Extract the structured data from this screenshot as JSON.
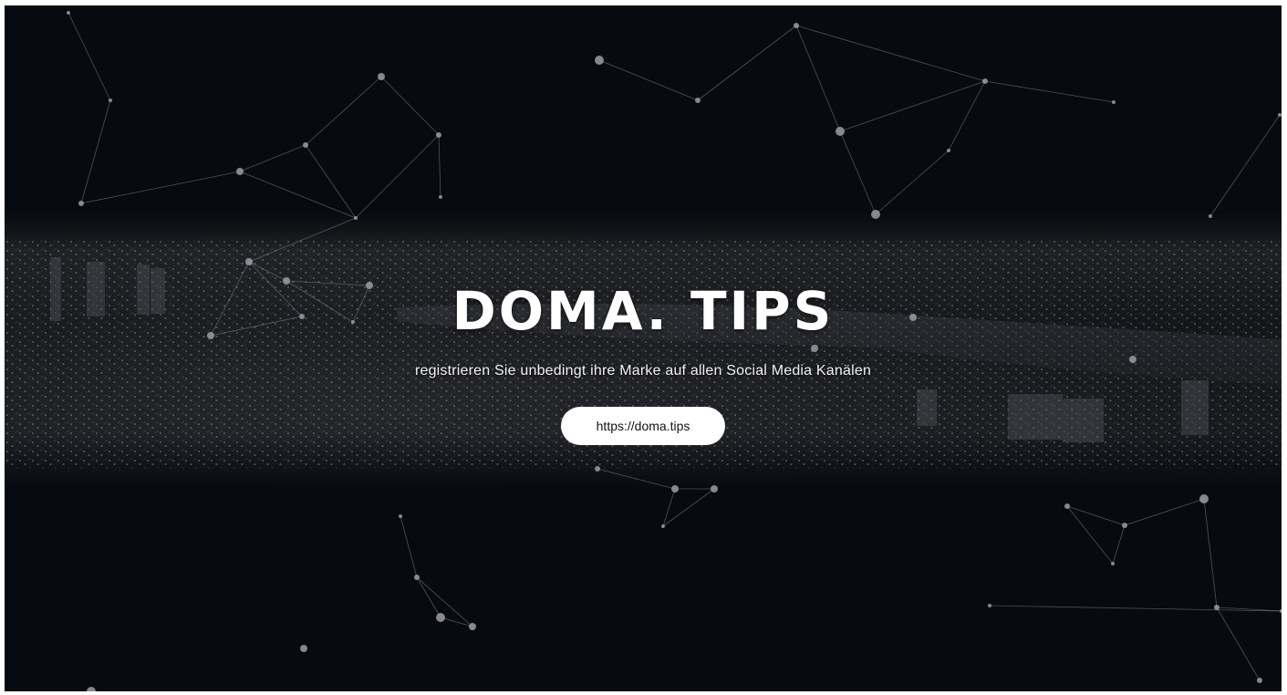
{
  "hero": {
    "title": "DOMA. TIPS",
    "subtitle": "registrieren Sie unbedingt ihre Marke auf allen Social Media Kanälen",
    "button_label": "https://doma.tips"
  },
  "colors": {
    "background": "#070a10",
    "button_bg": "#ffffff",
    "button_text": "#111111",
    "title": "#ffffff",
    "network_line": "#8a8d92",
    "network_node": "#9a9da2"
  },
  "icons": [
    "network-node-icon"
  ]
}
